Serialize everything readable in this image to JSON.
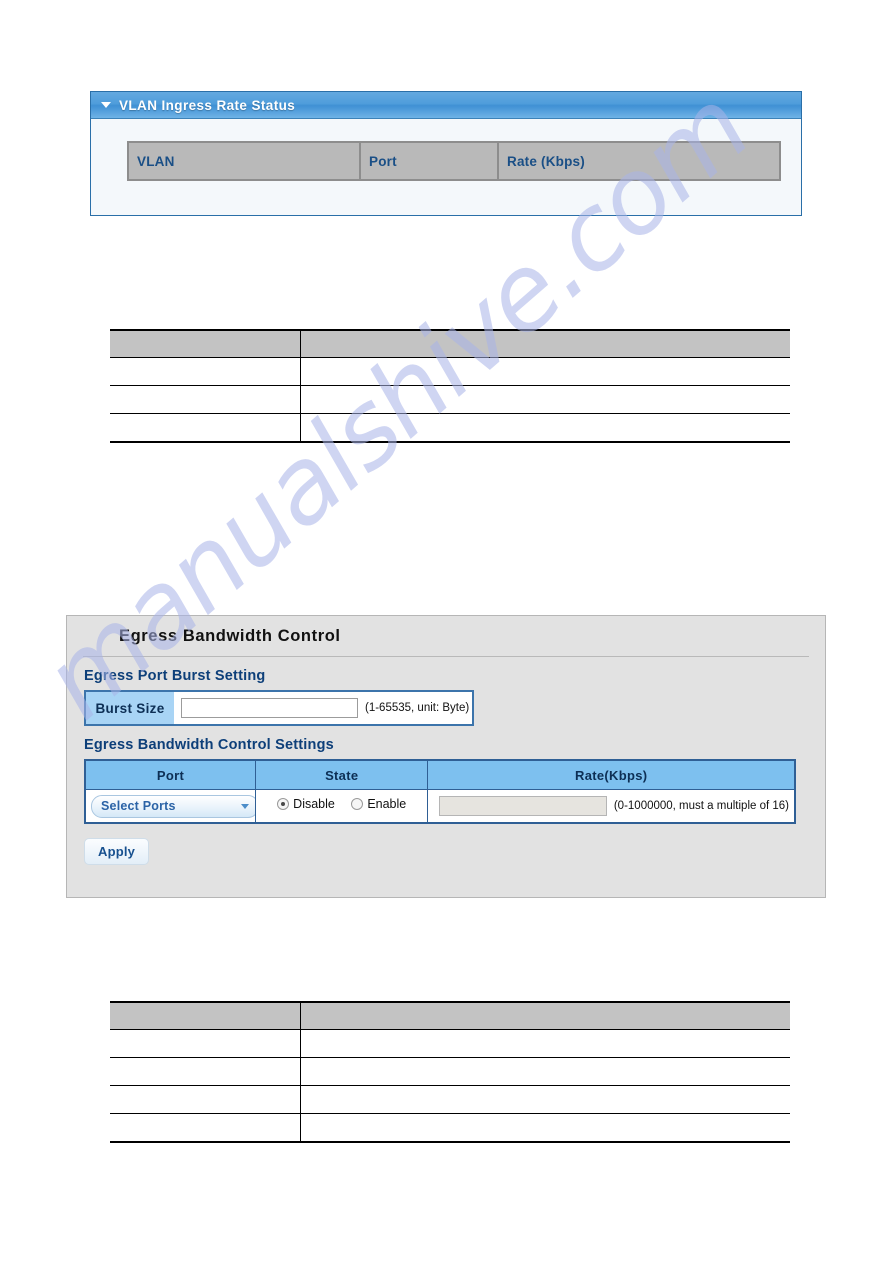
{
  "watermark": {
    "text": "manualshive.com"
  },
  "vlan_panel": {
    "title": "VLAN Ingress Rate Status",
    "collapse_icon": "triangle-down-icon",
    "table": {
      "columns": [
        "VLAN",
        "Port",
        "Rate (Kbps)"
      ],
      "rows": []
    }
  },
  "desc_table_1": {
    "columns": [
      "",
      ""
    ],
    "rows": [
      [
        "",
        ""
      ],
      [
        "",
        ""
      ],
      [
        "",
        ""
      ]
    ]
  },
  "desc_table_2": {
    "columns": [
      "",
      ""
    ],
    "rows": [
      [
        "",
        ""
      ],
      [
        "",
        ""
      ],
      [
        "",
        ""
      ],
      [
        "",
        ""
      ]
    ]
  },
  "egress_panel": {
    "title": "Egress Bandwidth Control",
    "burst_section": {
      "label": "Egress Port Burst Setting",
      "field_label": "Burst Size",
      "input_value": "",
      "input_placeholder": "",
      "hint": "(1-65535, unit: Byte)"
    },
    "settings_section": {
      "label": "Egress Bandwidth Control Settings",
      "columns": [
        "Port",
        "State",
        "Rate(Kbps)"
      ],
      "row": {
        "port_select_value": "Select Ports",
        "port_select_caret": "chevron-down-icon",
        "state_options": [
          "Disable",
          "Enable"
        ],
        "state_selected": "Disable",
        "rate_value": "",
        "rate_placeholder": "",
        "rate_hint": "(0-1000000, must a multiple of 16)"
      }
    },
    "apply_label": "Apply"
  },
  "colors": {
    "panel_header_blue": "#4f9ddb",
    "table_header_blue": "#7dc0ef",
    "label_blue": "#0d3f79",
    "border_blue": "#2f5f95",
    "gray_header": "#c3c3c3",
    "watermark": "#a9b4e8"
  }
}
